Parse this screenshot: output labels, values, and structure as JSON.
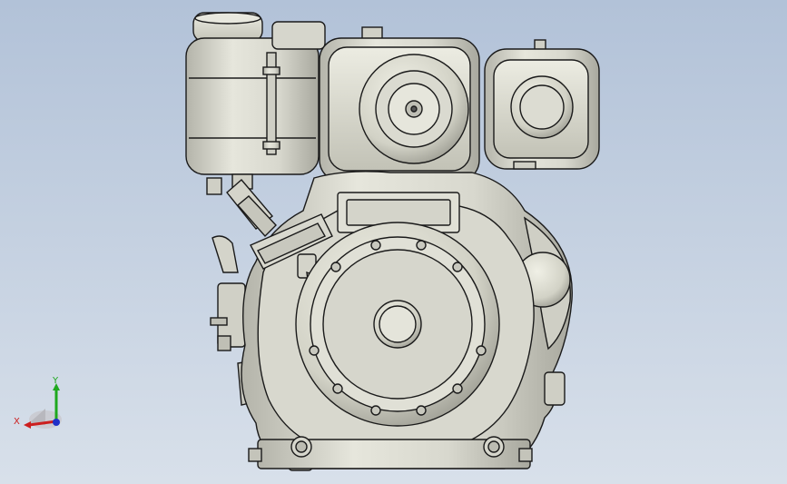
{
  "viewport": {
    "background_top": "#b2c2d8",
    "background_bottom": "#d8e0ea"
  },
  "model": {
    "body_color": "#dcdcd2",
    "edge_color": "#1a1a1a",
    "shade_color": "#b9b9ae"
  },
  "triad": {
    "x_label": "X",
    "y_label": "Y",
    "x_color": "#cc1f1f",
    "y_color": "#1ea81e",
    "z_color": "#2030c8"
  }
}
